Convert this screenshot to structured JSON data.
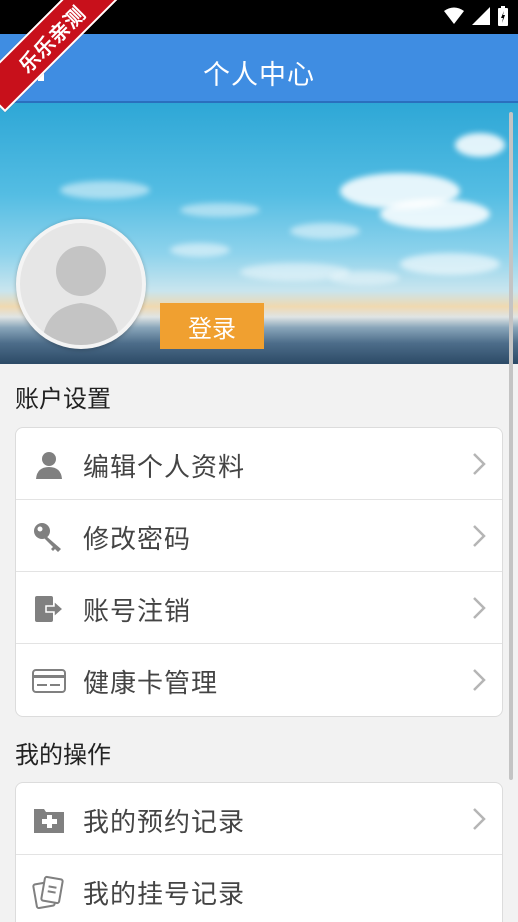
{
  "watermark": "乐乐亲测",
  "header": {
    "title": "个人中心"
  },
  "profile": {
    "login_label": "登录"
  },
  "sections": [
    {
      "title": "账户设置",
      "items": [
        {
          "icon": "user-icon",
          "label": "编辑个人资料"
        },
        {
          "icon": "key-icon",
          "label": "修改密码"
        },
        {
          "icon": "logout-icon",
          "label": "账号注销"
        },
        {
          "icon": "card-icon",
          "label": "健康卡管理"
        }
      ]
    },
    {
      "title": "我的操作",
      "items": [
        {
          "icon": "appointment-icon",
          "label": "我的预约记录"
        },
        {
          "icon": "registration-icon",
          "label": "我的挂号记录"
        }
      ]
    }
  ],
  "colors": {
    "header": "#3f8de2",
    "login_button": "#f0a030",
    "icon_gray": "#808080"
  }
}
